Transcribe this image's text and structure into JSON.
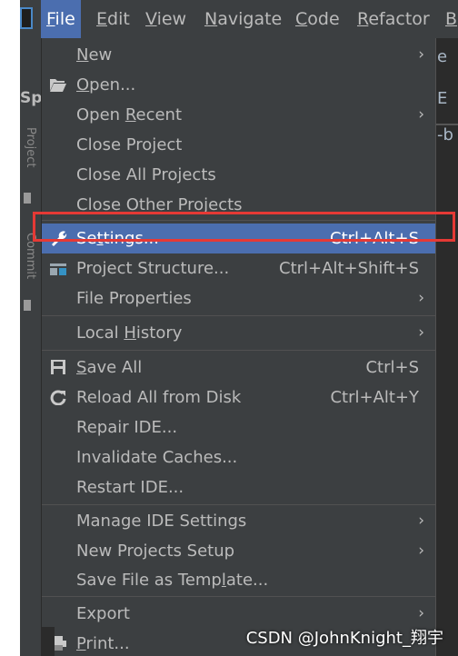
{
  "menubar": {
    "items": [
      {
        "prefix": "",
        "mnemonic": "F",
        "rest": "ile"
      },
      {
        "prefix": "",
        "mnemonic": "E",
        "rest": "dit"
      },
      {
        "prefix": "",
        "mnemonic": "V",
        "rest": "iew"
      },
      {
        "prefix": "",
        "mnemonic": "N",
        "rest": "avigate"
      },
      {
        "prefix": "",
        "mnemonic": "C",
        "rest": "ode"
      },
      {
        "prefix": "",
        "mnemonic": "R",
        "rest": "efactor"
      },
      {
        "prefix": "",
        "mnemonic": "B",
        "rest": ""
      }
    ]
  },
  "side": {
    "project_label": "Spı",
    "tab_project": "Project",
    "tab_commit": "Commit"
  },
  "right_peek": {
    "text_e": "e",
    "text_E": "Ε",
    "text_b": "-b"
  },
  "menu": {
    "items": [
      {
        "prefix": "",
        "mnemonic": "N",
        "rest": "ew",
        "shortcut": "",
        "arrow": "›",
        "icon": ""
      },
      {
        "prefix": "",
        "mnemonic": "O",
        "rest": "pen...",
        "shortcut": "",
        "arrow": "",
        "icon": "folder-open-icon"
      },
      {
        "prefix": "Open ",
        "mnemonic": "R",
        "rest": "ecent",
        "shortcut": "",
        "arrow": "›",
        "icon": ""
      },
      {
        "prefix": "Close Project",
        "mnemonic": "",
        "rest": "",
        "shortcut": "",
        "arrow": "",
        "icon": ""
      },
      {
        "prefix": "Close All Projects",
        "mnemonic": "",
        "rest": "",
        "shortcut": "",
        "arrow": "",
        "icon": ""
      },
      {
        "prefix": "Close Other Projects",
        "mnemonic": "",
        "rest": "",
        "shortcut": "",
        "arrow": "",
        "icon": ""
      },
      {
        "prefix": "Se",
        "mnemonic": "t",
        "rest": "tings...",
        "shortcut": "Ctrl+Alt+S",
        "arrow": "",
        "icon": "wrench-icon"
      },
      {
        "prefix": "Project Structure...",
        "mnemonic": "",
        "rest": "",
        "shortcut": "Ctrl+Alt+Shift+S",
        "arrow": "",
        "icon": "project-structure-icon"
      },
      {
        "prefix": "File Properties",
        "mnemonic": "",
        "rest": "",
        "shortcut": "",
        "arrow": "›",
        "icon": ""
      },
      {
        "prefix": "Local ",
        "mnemonic": "H",
        "rest": "istory",
        "shortcut": "",
        "arrow": "›",
        "icon": ""
      },
      {
        "prefix": "",
        "mnemonic": "S",
        "rest": "ave All",
        "shortcut": "Ctrl+S",
        "arrow": "",
        "icon": "save-icon"
      },
      {
        "prefix": "Reload All from Disk",
        "mnemonic": "",
        "rest": "",
        "shortcut": "Ctrl+Alt+Y",
        "arrow": "",
        "icon": "reload-icon"
      },
      {
        "prefix": "Repair IDE...",
        "mnemonic": "",
        "rest": "",
        "shortcut": "",
        "arrow": "",
        "icon": ""
      },
      {
        "prefix": "Invalidate Caches...",
        "mnemonic": "",
        "rest": "",
        "shortcut": "",
        "arrow": "",
        "icon": ""
      },
      {
        "prefix": "Restart IDE...",
        "mnemonic": "",
        "rest": "",
        "shortcut": "",
        "arrow": "",
        "icon": ""
      },
      {
        "prefix": "Manage IDE Settings",
        "mnemonic": "",
        "rest": "",
        "shortcut": "",
        "arrow": "›",
        "icon": ""
      },
      {
        "prefix": "New Projects Setup",
        "mnemonic": "",
        "rest": "",
        "shortcut": "",
        "arrow": "›",
        "icon": ""
      },
      {
        "prefix": "Save File as Temp",
        "mnemonic": "l",
        "rest": "ate...",
        "shortcut": "",
        "arrow": "",
        "icon": ""
      },
      {
        "prefix": "Export",
        "mnemonic": "",
        "rest": "",
        "shortcut": "",
        "arrow": "›",
        "icon": ""
      },
      {
        "prefix": "",
        "mnemonic": "P",
        "rest": "rint...",
        "shortcut": "",
        "arrow": "",
        "icon": "print-icon"
      }
    ]
  },
  "watermark": "CSDN @JohnKnight_翔宇",
  "colors": {
    "menu_bg": "#3c3f41",
    "highlight": "#4b6eaf",
    "text": "#bbbbbb",
    "annotation_box": "#e53935"
  }
}
